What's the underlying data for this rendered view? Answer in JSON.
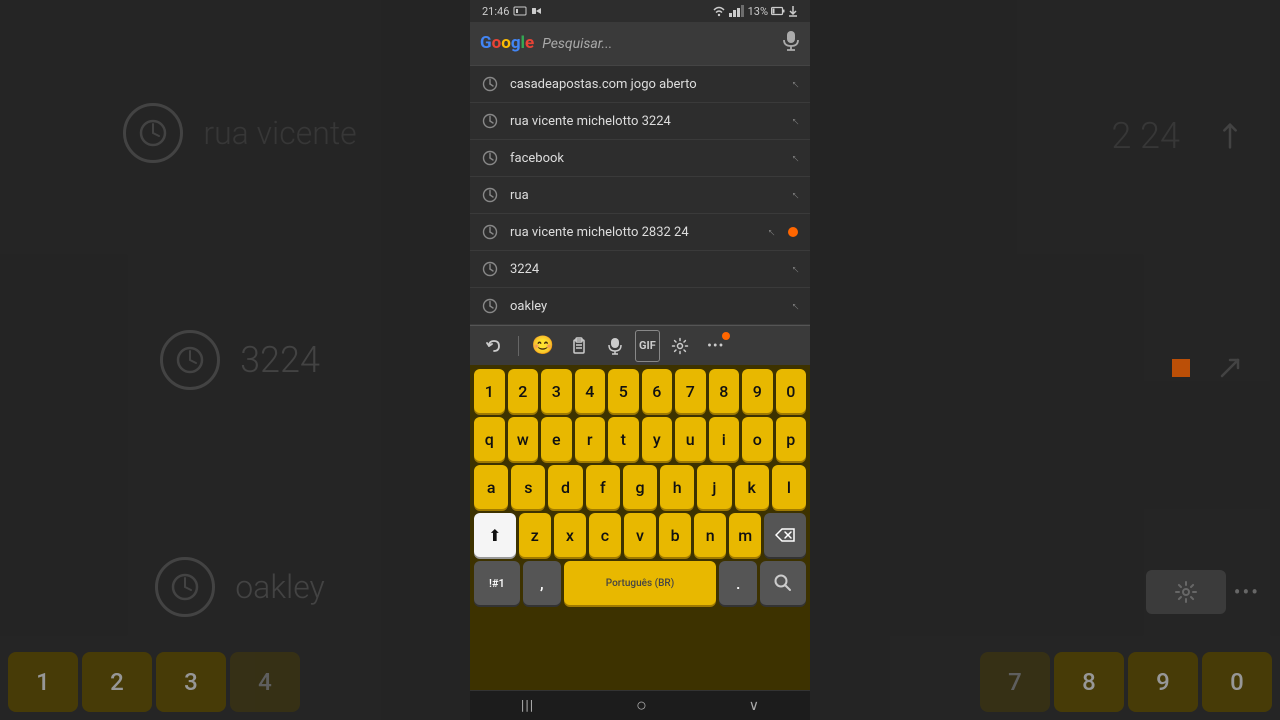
{
  "statusBar": {
    "time": "21:46",
    "battery": "13%",
    "icons": [
      "sim",
      "wifi",
      "signal"
    ]
  },
  "searchBar": {
    "placeholder": "Pesquisar...",
    "micLabel": "mic"
  },
  "suggestions": [
    {
      "id": 1,
      "text": "casadeapostas.com jogo aberto",
      "hasOrangeDot": false
    },
    {
      "id": 2,
      "text": "rua vicente michelotto 3224",
      "hasOrangeDot": false
    },
    {
      "id": 3,
      "text": "facebook",
      "hasOrangeDot": false
    },
    {
      "id": 4,
      "text": "rua",
      "hasOrangeDot": false
    },
    {
      "id": 5,
      "text": "rua vicente michelotto 2832 24",
      "hasOrangeDot": true
    },
    {
      "id": 6,
      "text": "3224",
      "hasOrangeDot": false
    },
    {
      "id": 7,
      "text": "oakley",
      "hasOrangeDot": false
    }
  ],
  "keyboardToolbar": {
    "icons": [
      "↺",
      "😊",
      "☰",
      "🎤",
      "GIF",
      "⚙",
      "•••"
    ]
  },
  "keyboard": {
    "row1": [
      "1",
      "2",
      "3",
      "4",
      "5",
      "6",
      "7",
      "8",
      "9",
      "0"
    ],
    "row2": [
      "q",
      "w",
      "e",
      "r",
      "t",
      "y",
      "u",
      "i",
      "o",
      "p"
    ],
    "row3": [
      "a",
      "s",
      "d",
      "f",
      "g",
      "h",
      "j",
      "k",
      "l"
    ],
    "row4": [
      "z",
      "x",
      "c",
      "v",
      "b",
      "n",
      "m"
    ],
    "row5_special": [
      "!#1",
      ",",
      "Português (BR)",
      ".",
      "🔍"
    ],
    "shiftLabel": "⬆",
    "backspaceLabel": "⌫"
  },
  "navBar": {
    "back": "|||",
    "home": "○",
    "recent": "∨"
  },
  "background": {
    "leftItems": [
      {
        "icon": "clock",
        "text": ""
      },
      {
        "icon": "clock",
        "text": "3224"
      },
      {
        "icon": "clock",
        "text": "oakley"
      }
    ],
    "rightItems": [
      {
        "icon": "arrow",
        "text": "2 24"
      },
      {
        "icon": "arrow",
        "text": ""
      },
      {
        "icon": "arrow",
        "text": ""
      }
    ]
  }
}
